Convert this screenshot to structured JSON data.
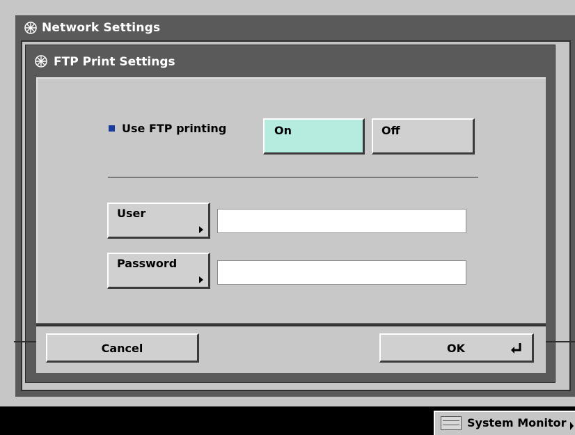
{
  "window": {
    "title": "Network Settings"
  },
  "dialog": {
    "title": "FTP Print Settings"
  },
  "ftp_printing": {
    "label": "Use FTP printing",
    "on_label": "On",
    "off_label": "Off",
    "selected": "On",
    "selected_color": "#b6ece0"
  },
  "fields": {
    "user": {
      "label": "User",
      "value": ""
    },
    "password": {
      "label": "Password",
      "value": ""
    }
  },
  "footer": {
    "cancel_label": "Cancel",
    "ok_label": "OK"
  },
  "status_bar": {
    "system_monitor_label": "System Monitor"
  },
  "icons": {
    "title_icon": "gear-flower-icon",
    "ok_icon": "return-arrow-icon",
    "field_button_icon": "triangle-right-icon",
    "system_monitor_icon": "monitor-lines-icon"
  }
}
